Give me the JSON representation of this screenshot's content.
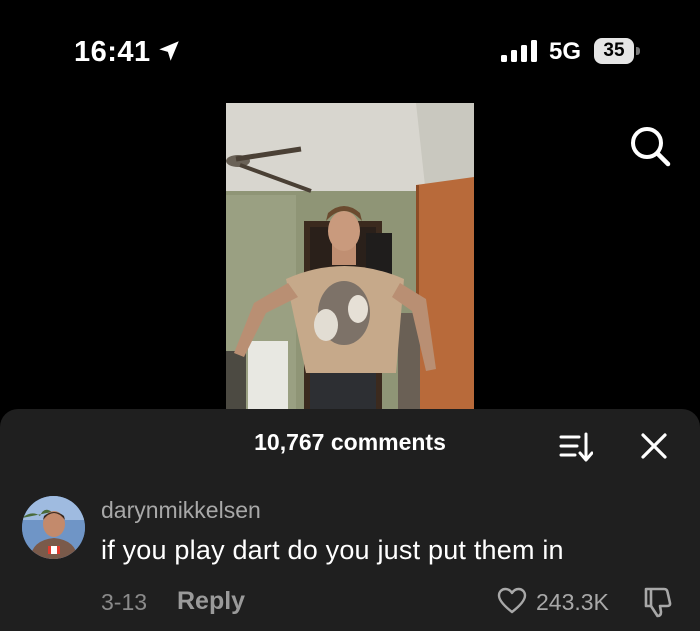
{
  "status_bar": {
    "time": "16:41",
    "network": "5G",
    "battery": "35",
    "location_icon": "location-arrow-icon",
    "signal_icon": "cellular-signal-icon"
  },
  "header": {
    "search_icon": "search-icon"
  },
  "video": {
    "description": "video-frame"
  },
  "comments": {
    "count_label": "10,767 comments",
    "sort_icon": "sort-icon",
    "close_icon": "close-icon",
    "items": [
      {
        "username": "darynmikkelsen",
        "text": "if you play dart do you just put them in",
        "date": "3-13",
        "reply_label": "Reply",
        "likes": "243.3K"
      }
    ]
  },
  "colors": {
    "background": "#000000",
    "sheet": "#1f1f1f",
    "muted_text": "#a8a8a8"
  }
}
